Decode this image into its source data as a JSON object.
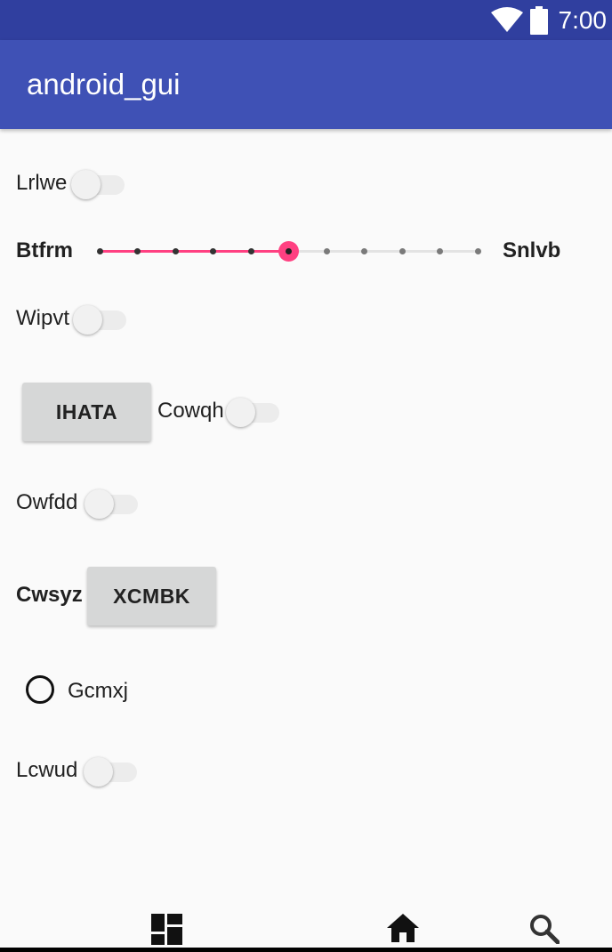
{
  "status_bar": {
    "time": "7:00",
    "icons": [
      "wifi-icon",
      "battery-icon"
    ]
  },
  "app_bar": {
    "title": "android_gui"
  },
  "form": {
    "switch_1": {
      "label": "Lrlwe",
      "checked": false
    },
    "slider": {
      "left_label": "Btfrm",
      "right_label": "Snlvb",
      "value": 5,
      "min": 0,
      "max": 10
    },
    "switch_2": {
      "label": "Wipvt",
      "checked": false
    },
    "button_1": {
      "label": "IHATA"
    },
    "switch_3": {
      "label": "Cowqh",
      "checked": false
    },
    "switch_4": {
      "label": "Owfdd",
      "checked": false
    },
    "button_2_label_prefix": "Cwsyz",
    "button_2": {
      "label": "XCMBK"
    },
    "radio_1": {
      "label": "Gcmxj",
      "checked": false
    },
    "switch_5": {
      "label": "Lcwud",
      "checked": false
    }
  },
  "bottom_nav": {
    "icons": [
      "dashboard-icon",
      "home-icon",
      "search-icon"
    ]
  },
  "colors": {
    "status_bar": "#303f9f",
    "app_bar": "#3f51b5",
    "accent": "#ff4081",
    "background": "#fafafa"
  }
}
